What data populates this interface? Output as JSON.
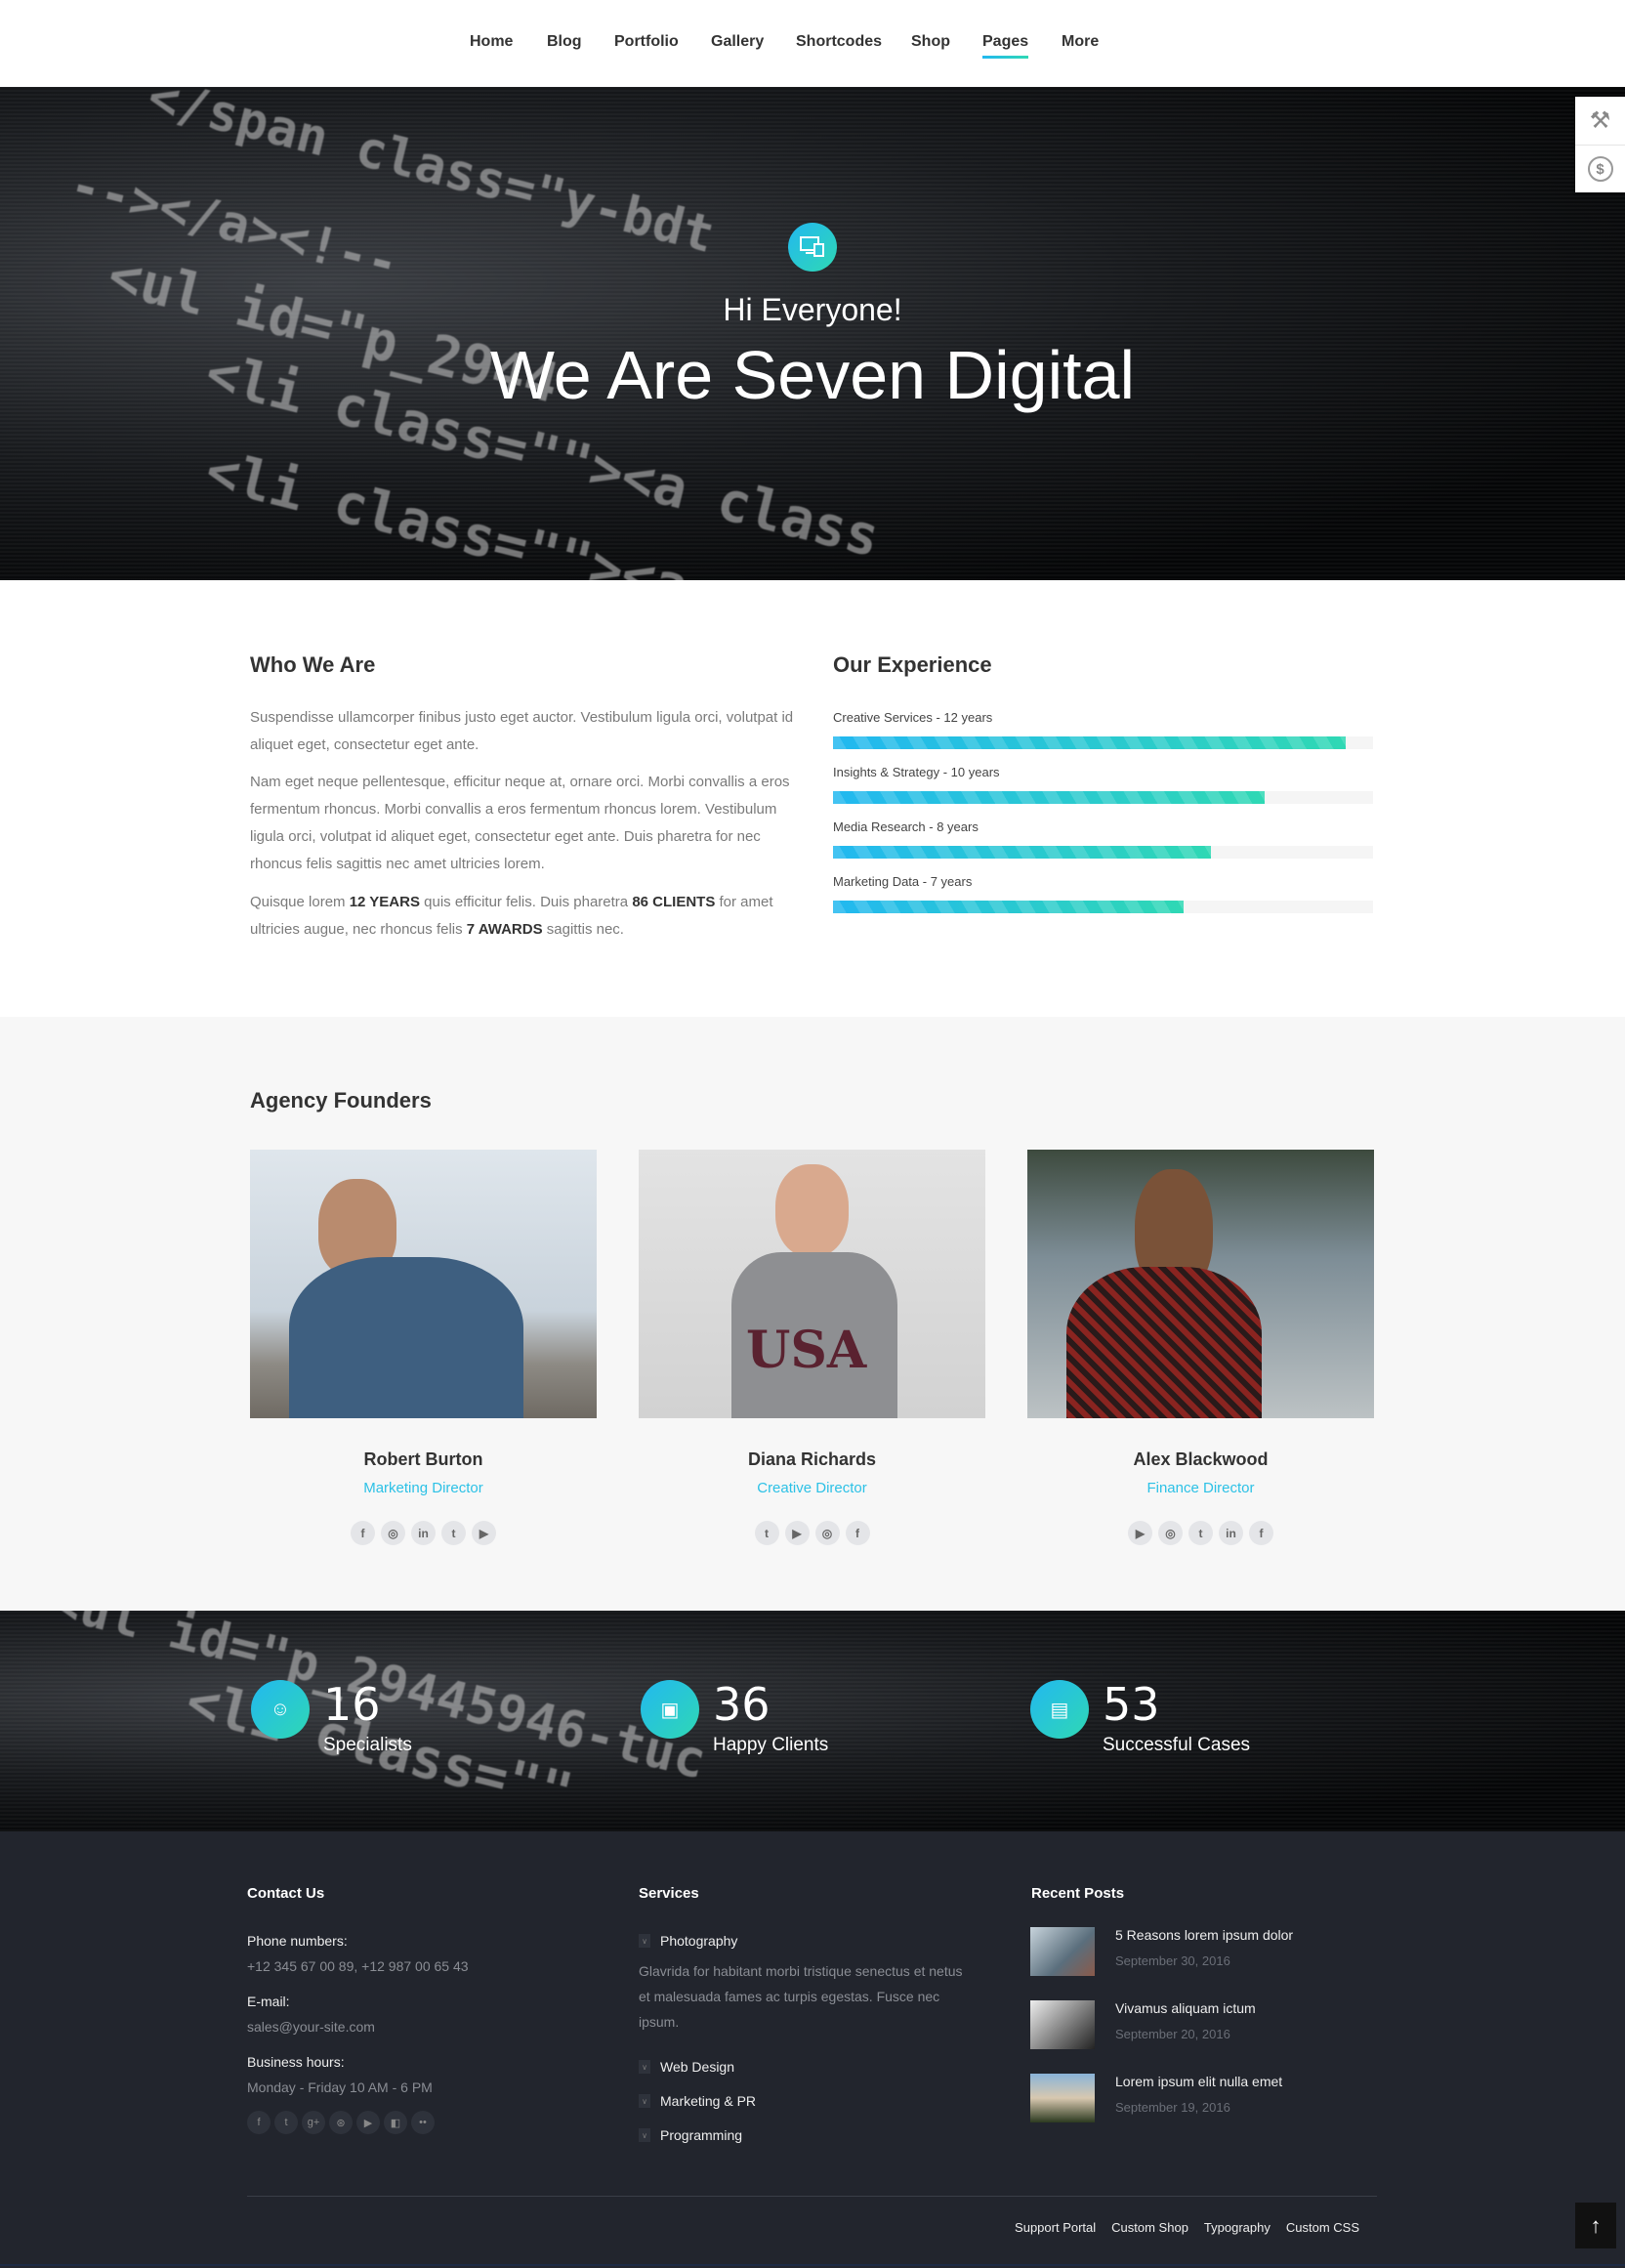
{
  "nav": {
    "items": [
      {
        "label": "Home",
        "active": false
      },
      {
        "label": "Blog",
        "active": false
      },
      {
        "label": "Portfolio",
        "active": false
      },
      {
        "label": "Gallery",
        "active": false
      },
      {
        "label": "Shortcodes",
        "active": false
      },
      {
        "label": "Shop",
        "active": false
      },
      {
        "label": "Pages",
        "active": true
      },
      {
        "label": "More",
        "active": false
      }
    ]
  },
  "side_panel": {
    "icons": [
      "tools-icon",
      "dollar-icon"
    ]
  },
  "hero": {
    "icon": "monitor-devices-icon",
    "greeting": "Hi Everyone!",
    "title": "We Are Seven Digital"
  },
  "who": {
    "heading": "Who We Are",
    "p1": "Suspendisse ullamcorper finibus justo eget auctor. Vestibulum ligula orci, volutpat id aliquet eget, consectetur eget ante.",
    "p2": "Nam eget neque pellentesque, efficitur neque at, ornare orci. Morbi convallis a eros fermentum rhoncus. Morbi convallis a eros fermentum rhoncus lorem. Vestibulum ligula orci, volutpat id aliquet eget, consectetur eget ante. Duis pharetra for nec rhoncus felis sagittis nec amet ultricies lorem.",
    "p3": {
      "t1": "Quisque lorem ",
      "b1": "12 YEARS",
      "t2": " quis efficitur felis. Duis pharetra ",
      "b2": "86 CLIENTS",
      "t3": " for amet ultricies augue, nec rhoncus felis ",
      "b3": "7 AWARDS",
      "t4": " sagittis nec."
    }
  },
  "experience": {
    "heading": "Our Experience",
    "bars": [
      {
        "label": "Creative Services - 12 years",
        "percent": 95
      },
      {
        "label": "Insights & Strategy - 10 years",
        "percent": 80
      },
      {
        "label": "Media Research - 8 years",
        "percent": 70
      },
      {
        "label": "Marketing Data - 7 years",
        "percent": 65
      }
    ],
    "colors": {
      "start": "#22b8f0",
      "end": "#2fd8b4"
    }
  },
  "founders": {
    "heading": "Agency Founders",
    "people": [
      {
        "name": "Robert Burton",
        "role": "Marketing Director",
        "socials": [
          "facebook",
          "instagram",
          "linkedin",
          "twitter",
          "youtube"
        ]
      },
      {
        "name": "Diana Richards",
        "role": "Creative Director",
        "socials": [
          "twitter",
          "youtube",
          "instagram",
          "facebook"
        ]
      },
      {
        "name": "Alex Blackwood",
        "role": "Finance Director",
        "socials": [
          "youtube",
          "instagram",
          "twitter",
          "linkedin",
          "facebook"
        ]
      }
    ]
  },
  "stats": [
    {
      "value": "16",
      "label": "Specialists",
      "icon": "id-badge-icon"
    },
    {
      "value": "36",
      "label": "Happy Clients",
      "icon": "contact-card-icon"
    },
    {
      "value": "53",
      "label": "Successful Cases",
      "icon": "briefcase-icon"
    }
  ],
  "footer": {
    "contact": {
      "heading": "Contact Us",
      "phone_label": "Phone numbers:",
      "phone": "+12 345 67 00 89, +12 987 00 65 43",
      "email_label": "E-mail:",
      "email": "sales@your-site.com",
      "hours_label": "Business hours:",
      "hours": "Monday - Friday 10 AM - 6 PM",
      "socials": [
        "facebook",
        "twitter",
        "google-plus",
        "dribbble",
        "youtube",
        "delicious",
        "flickr"
      ]
    },
    "services": {
      "heading": "Services",
      "items": [
        "Photography",
        "Web Design",
        "Marketing & PR",
        "Programming"
      ],
      "desc": "Glavrida for habitant morbi tristique senectus et netus et malesuada fames ac turpis egestas. Fusce nec ipsum."
    },
    "posts": {
      "heading": "Recent Posts",
      "items": [
        {
          "title": "5 Reasons lorem ipsum dolor",
          "date": "September 30, 2016"
        },
        {
          "title": "Vivamus aliquam ictum",
          "date": "September 20, 2016"
        },
        {
          "title": "Lorem ipsum elit nulla emet",
          "date": "September 19, 2016"
        }
      ]
    },
    "links": [
      "Support Portal",
      "Custom Shop",
      "Typography",
      "Custom CSS"
    ]
  }
}
